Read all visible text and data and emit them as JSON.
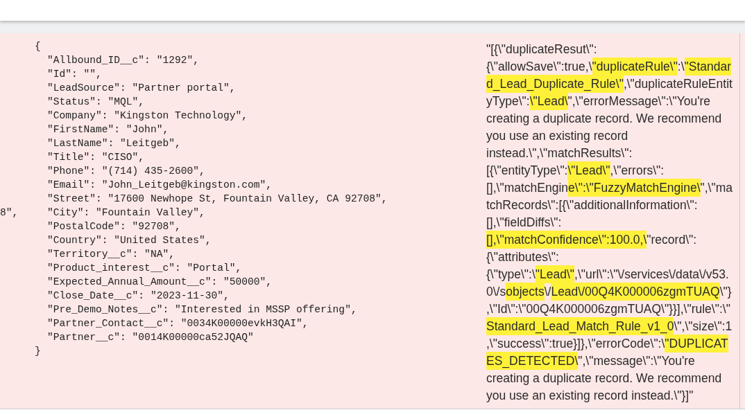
{
  "left_fragment": "8\",",
  "request_json": {
    "open": "{",
    "close": "}",
    "fields": [
      "\"Allbound_ID__c\": \"1292\",",
      "\"Id\": \"\",",
      "\"LeadSource\": \"Partner portal\",",
      "\"Status\": \"MQL\",",
      "\"Company\": \"Kingston Technology\",",
      "\"FirstName\": \"John\",",
      "\"LastName\": \"Leitgeb\",",
      "\"Title\": \"CISO\",",
      "\"Phone\": \"(714) 435-2600\",",
      "\"Email\": \"John_Leitgeb@kingston.com\",",
      "\"Street\": \"17600 Newhope St, Fountain Valley, CA 92708\",",
      "\"City\": \"Fountain Valley\",",
      "\"PostalCode\": \"92708\",",
      "\"Country\": \"United States\",",
      "\"Territory__c\": \"NA\",",
      "\"Product_interest__c\": \"Portal\",",
      "\"Expected_Annual_Amount__c\": \"50000\",",
      "\"Close_Date__c\": \"2023-11-30\",",
      "\"Pre_Demo_Notes__c\": \"Interested in MSSP offering\",",
      "\"Partner_Contact__c\": \"0034K00000evkH3QAI\",",
      "\"Partner__c\": \"0014K00000ca52JQAQ\""
    ]
  },
  "response_lines": [
    [
      {
        "text": "\"[{\\\"duplicateResut\\\":",
        "highlighted": false
      }
    ],
    [
      {
        "text": "{\\\"allowSave\\\":true,\\",
        "highlighted": false
      },
      {
        "text": "\"duplicateRule\\\"",
        "highlighted": true
      },
      {
        "text": ":\\",
        "highlighted": false
      },
      {
        "text": "\"Standar",
        "highlighted": true
      }
    ],
    [
      {
        "text": "d_Lead_Duplicate_Rule\\\"",
        "highlighted": true
      },
      {
        "text": ",\\\"duplicateRuleEntit",
        "highlighted": false
      }
    ],
    [
      {
        "text": "yType\\\":",
        "highlighted": false
      },
      {
        "text": "\\\"Lead\\",
        "highlighted": true
      },
      {
        "text": "\",\\\"errorMessage\\\":\\\"You're",
        "highlighted": false
      }
    ],
    [
      {
        "text": "creating a duplicate record. We recommend",
        "highlighted": false
      }
    ],
    [
      {
        "text": "you use an existing record",
        "highlighted": false
      }
    ],
    [
      {
        "text": "instead.\\\",\\\"matchResults\\\":",
        "highlighted": false
      }
    ],
    [
      {
        "text": "[{\\\"entityType\\\":",
        "highlighted": false
      },
      {
        "text": "\\\"Lead\\\"",
        "highlighted": true
      },
      {
        "text": ",\\\"errors\\\":",
        "highlighted": false
      }
    ],
    [
      {
        "text": "[],\\\"matchEngin",
        "highlighted": false
      },
      {
        "text": "e\\\":\\\"FuzzyMatchEngine\\",
        "highlighted": true
      },
      {
        "text": "\",\\\"ma",
        "highlighted": false
      }
    ],
    [
      {
        "text": "tchRecords\\\":[{\\\"additionalInformation\\\":",
        "highlighted": false
      }
    ],
    [
      {
        "text": "[],\\\"fieldDiffs\\\":",
        "highlighted": false
      }
    ],
    [
      {
        "text": "[],\\\"matchConfidence\\\":100.0,\\",
        "highlighted": true
      },
      {
        "text": "\"record\\\":",
        "highlighted": false
      }
    ],
    [
      {
        "text": "{\\\"attributes\\\":",
        "highlighted": false
      }
    ],
    [
      {
        "text": "{\\\"type\\\":\\",
        "highlighted": false
      },
      {
        "text": "\"Lead\\\"",
        "highlighted": true
      },
      {
        "text": ",\\\"url\\\":\\\"\\/services\\/data\\/v53.",
        "highlighted": false
      }
    ],
    [
      {
        "text": "0\\/s",
        "highlighted": false
      },
      {
        "text": "objects",
        "highlighted": true
      },
      {
        "text": "\\/",
        "highlighted": false
      },
      {
        "text": "Lead\\/00Q4K000006zgmTUAQ",
        "highlighted": true
      },
      {
        "text": "\\\"}",
        "highlighted": false
      }
    ],
    [
      {
        "text": ",\\\"Id\\\":\\\"00Q4K000006zgmTUAQ\\\"}}],\\\"rule\\\":\\\"",
        "highlighted": false
      }
    ],
    [
      {
        "text": "Standard_Lead_Match_Rule_v1_0",
        "highlighted": true
      },
      {
        "text": "\\\",\\\"size\\\":1",
        "highlighted": false
      }
    ],
    [
      {
        "text": ",\\\"success\\\":true}]},\\\"errorCode\\\":\\",
        "highlighted": false
      },
      {
        "text": "\"DUPLICAT",
        "highlighted": true
      }
    ],
    [
      {
        "text": "ES_DETECTED\\",
        "highlighted": true
      },
      {
        "text": "\",\\\"message\\\":\\\"You're",
        "highlighted": false
      }
    ],
    [
      {
        "text": "creating a duplicate record. We recommend",
        "highlighted": false
      }
    ],
    [
      {
        "text": "you use an existing record instead.\\\"}]\"",
        "highlighted": false
      }
    ]
  ]
}
